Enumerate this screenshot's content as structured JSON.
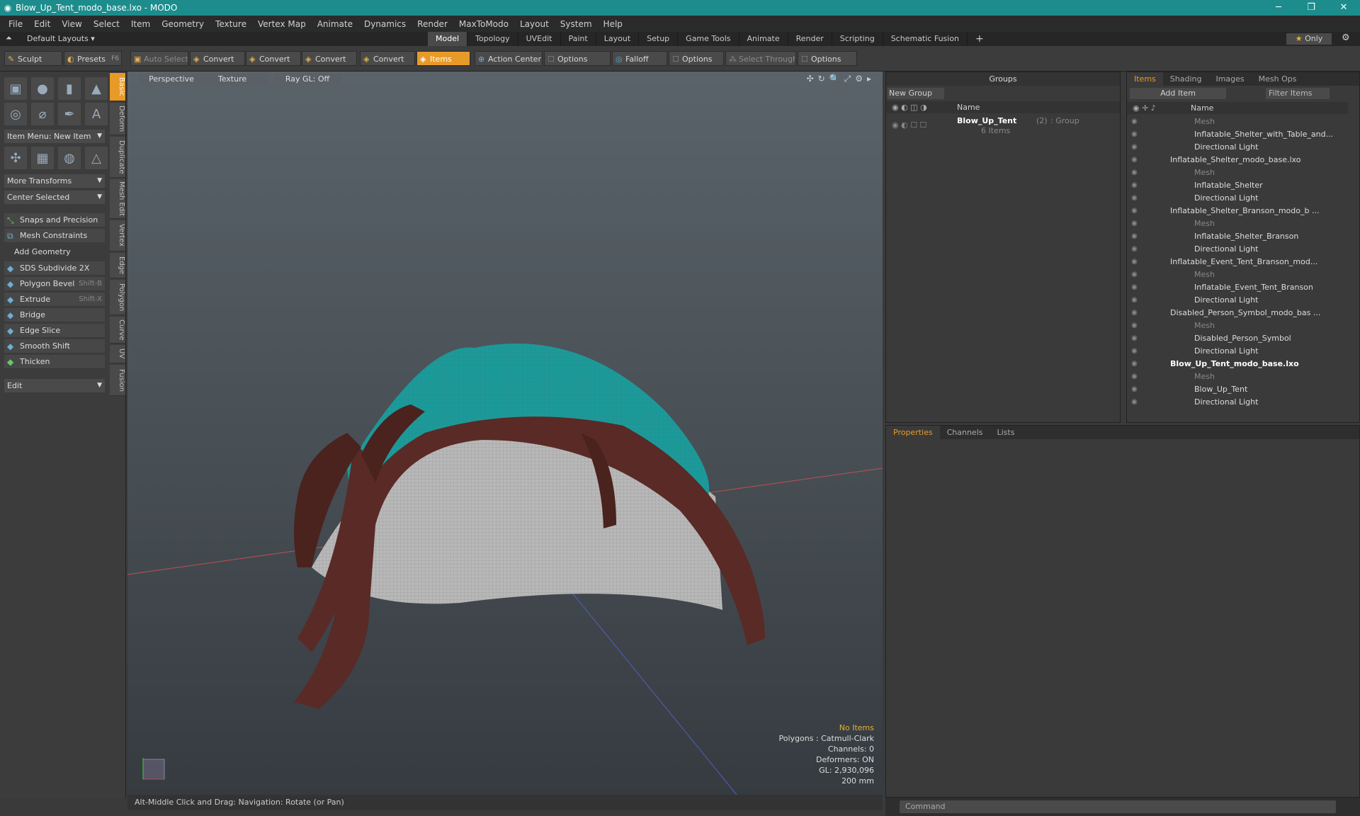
{
  "window": {
    "title": "Blow_Up_Tent_modo_base.lxo - MODO"
  },
  "menu": [
    "File",
    "Edit",
    "View",
    "Select",
    "Item",
    "Geometry",
    "Texture",
    "Vertex Map",
    "Animate",
    "Dynamics",
    "Render",
    "MaxToModo",
    "Layout",
    "System",
    "Help"
  ],
  "layouts": {
    "default": "Default Layouts ▾",
    "tabs": [
      "Model",
      "Topology",
      "UVEdit",
      "Paint",
      "Layout",
      "Setup",
      "Game Tools",
      "Animate",
      "Render",
      "Scripting",
      "Schematic Fusion"
    ],
    "only": "Only"
  },
  "toolbar": {
    "sculpt": "Sculpt",
    "presets": "Presets",
    "presets_key": "F6",
    "auto_select": "Auto Select",
    "convert1": "Convert",
    "convert2": "Convert",
    "convert3": "Convert",
    "convert4": "Convert",
    "items": "Items",
    "action_center": "Action Center",
    "options1": "Options",
    "falloff": "Falloff",
    "options2": "Options",
    "select_through": "Select Through",
    "options3": "Options"
  },
  "left": {
    "vtabs": [
      "Basic",
      "Deform",
      "Duplicate",
      "Mesh Edit",
      "Vertex",
      "Edge",
      "Polygon",
      "Curve",
      "UV",
      "Fusion"
    ],
    "item_menu": "Item Menu: New Item",
    "more_transforms": "More Transforms",
    "center_selected": "Center Selected",
    "snaps": "Snaps and Precision",
    "constraints": "Mesh Constraints",
    "add_geometry": "Add Geometry",
    "tools": [
      {
        "label": "SDS Subdivide 2X",
        "key": ""
      },
      {
        "label": "Polygon Bevel",
        "key": "Shift-B"
      },
      {
        "label": "Extrude",
        "key": "Shift-X"
      },
      {
        "label": "Bridge",
        "key": ""
      },
      {
        "label": "Edge Slice",
        "key": ""
      },
      {
        "label": "Smooth Shift",
        "key": ""
      },
      {
        "label": "Thicken",
        "key": ""
      }
    ],
    "edit": "Edit"
  },
  "viewport": {
    "perspective": "Perspective",
    "texture": "Texture",
    "raygl": "Ray GL: Off",
    "info": {
      "items": "No Items",
      "polygons": "Polygons : Catmull-Clark",
      "channels": "Channels: 0",
      "deformers": "Deformers: ON",
      "gl": "GL: 2,930,096",
      "size": "200 mm"
    }
  },
  "status": "Alt-Middle Click and Drag:   Navigation: Rotate (or Pan)",
  "groups": {
    "title": "Groups",
    "new_group": "New Group",
    "col_name": "Name",
    "group_name": "Blow_Up_Tent",
    "group_count": "(2)",
    "group_type": ": Group",
    "group_items": "6 Items"
  },
  "items": {
    "tabs": [
      "Items",
      "Shading",
      "Images",
      "Mesh Ops"
    ],
    "add_item": "Add Item",
    "filter": "Filter Items",
    "col_name": "Name",
    "rows": [
      {
        "label": "Mesh",
        "indent": 5,
        "style": "dim"
      },
      {
        "label": "Inflatable_Shelter_with_Table_and...",
        "indent": 5,
        "style": ""
      },
      {
        "label": "Directional Light",
        "indent": 5,
        "style": ""
      },
      {
        "label": "Inflatable_Shelter_modo_base.lxo",
        "indent": 3,
        "style": ""
      },
      {
        "label": "Mesh",
        "indent": 5,
        "style": "dim"
      },
      {
        "label": "Inflatable_Shelter",
        "indent": 5,
        "style": ""
      },
      {
        "label": "Directional Light",
        "indent": 5,
        "style": ""
      },
      {
        "label": "Inflatable_Shelter_Branson_modo_b ...",
        "indent": 3,
        "style": ""
      },
      {
        "label": "Mesh",
        "indent": 5,
        "style": "dim"
      },
      {
        "label": "Inflatable_Shelter_Branson",
        "indent": 5,
        "style": ""
      },
      {
        "label": "Directional Light",
        "indent": 5,
        "style": ""
      },
      {
        "label": "Inflatable_Event_Tent_Branson_mod...",
        "indent": 3,
        "style": ""
      },
      {
        "label": "Mesh",
        "indent": 5,
        "style": "dim"
      },
      {
        "label": "Inflatable_Event_Tent_Branson",
        "indent": 5,
        "style": ""
      },
      {
        "label": "Directional Light",
        "indent": 5,
        "style": ""
      },
      {
        "label": "Disabled_Person_Symbol_modo_bas ...",
        "indent": 3,
        "style": ""
      },
      {
        "label": "Mesh",
        "indent": 5,
        "style": "dim"
      },
      {
        "label": "Disabled_Person_Symbol",
        "indent": 5,
        "style": ""
      },
      {
        "label": "Directional Light",
        "indent": 5,
        "style": ""
      },
      {
        "label": "Blow_Up_Tent_modo_base.lxo",
        "indent": 3,
        "style": "bold"
      },
      {
        "label": "Mesh",
        "indent": 5,
        "style": "dim"
      },
      {
        "label": "Blow_Up_Tent",
        "indent": 5,
        "style": ""
      },
      {
        "label": "Directional Light",
        "indent": 5,
        "style": ""
      }
    ]
  },
  "props": {
    "tabs": [
      "Properties",
      "Channels",
      "Lists"
    ]
  },
  "command": {
    "placeholder": "Command"
  }
}
